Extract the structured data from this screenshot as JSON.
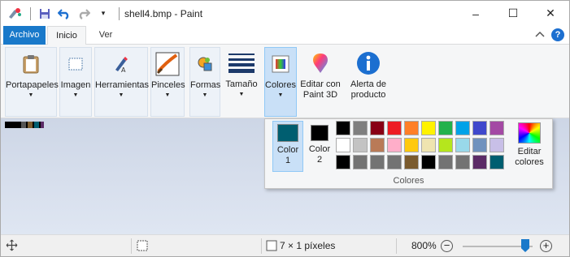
{
  "window": {
    "title": "shell4.bmp - Paint",
    "controls": {
      "minimize": "–",
      "maximize": "☐",
      "close": "✕"
    }
  },
  "quick_access": {
    "customize": "▾"
  },
  "tabs": [
    {
      "label": "Archivo"
    },
    {
      "label": "Inicio"
    },
    {
      "label": "Ver"
    }
  ],
  "ribbon": {
    "groups": [
      {
        "label": "Portapapeles"
      },
      {
        "label": "Imagen"
      },
      {
        "label": "Herramientas"
      },
      {
        "label": "Pinceles"
      },
      {
        "label": "Formas"
      },
      {
        "label": "Tamaño"
      },
      {
        "label": "Colores"
      },
      {
        "label": "Editar con\nPaint 3D"
      },
      {
        "label": "Alerta de\nproducto"
      }
    ]
  },
  "colors_panel": {
    "color1_label": "Color\n1",
    "color2_label": "Color\n2",
    "color1": "#005e70",
    "color2": "#000000",
    "edit_label": "Editar\ncolores",
    "group_label": "Colores",
    "palette": [
      [
        "#000000",
        "#7f7f7f",
        "#880015",
        "#ed1c24",
        "#ff7f27",
        "#fff200",
        "#22b14c",
        "#00a2e8",
        "#3f48cc",
        "#a349a4"
      ],
      [
        "#ffffff",
        "#c3c3c3",
        "#b97a57",
        "#ffaec9",
        "#ffc90e",
        "#efe4b0",
        "#b5e61d",
        "#99d9ea",
        "#7092be",
        "#c8bfe7"
      ],
      [
        "#000000",
        "#737373",
        "#737373",
        "#737373",
        "#7a5b2e",
        "#000000",
        "#737373",
        "#737373",
        "#5b2b66",
        "#005e70"
      ]
    ]
  },
  "status": {
    "dimensions": "7 × 1 píxeles",
    "zoom": "800%",
    "zoom_out": "−",
    "zoom_in": "+"
  }
}
